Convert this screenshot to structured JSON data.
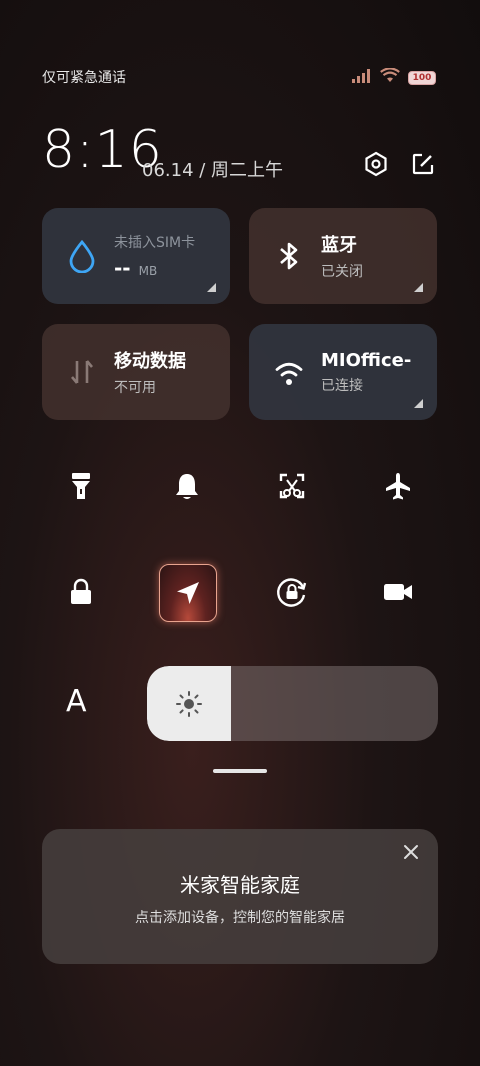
{
  "status_bar": {
    "carrier_text": "仅可紧急通话",
    "battery_level": "100",
    "icons": [
      "signal-icon",
      "wifi-icon",
      "battery-icon"
    ]
  },
  "header": {
    "time": "8:16",
    "date": "06.14 / 周二上午",
    "icons": [
      "settings-icon",
      "edit-icon"
    ]
  },
  "tiles": {
    "data_usage": {
      "label": "未插入SIM卡",
      "value": "--",
      "unit": "MB"
    },
    "bluetooth": {
      "title": "蓝牙",
      "status": "已关闭"
    },
    "mobile_data": {
      "title": "移动数据",
      "status": "不可用"
    },
    "wifi": {
      "title": "MIOffice-",
      "status": "已连接"
    }
  },
  "toggles": [
    {
      "icon": "flashlight-icon",
      "active": false
    },
    {
      "icon": "bell-icon",
      "active": false
    },
    {
      "icon": "screenshot-icon",
      "active": false
    },
    {
      "icon": "airplane-icon",
      "active": false
    },
    {
      "icon": "lock-icon",
      "active": false
    },
    {
      "icon": "location-icon",
      "active": true
    },
    {
      "icon": "rotation-lock-icon",
      "active": false
    },
    {
      "icon": "video-camera-icon",
      "active": false
    }
  ],
  "brightness": {
    "auto_label": "A",
    "level": 0.29
  },
  "mi_home_card": {
    "title": "米家智能家庭",
    "subtitle": "点击添加设备，控制您的智能家居"
  },
  "colors": {
    "wifi_tile": "#323741",
    "brown_tile": "#44322e",
    "water_drop": "#3ea6f5",
    "active_accent": "#e9a48f"
  }
}
